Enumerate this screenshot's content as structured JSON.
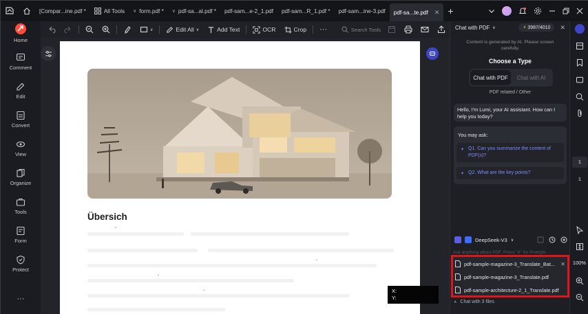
{
  "tabs": [
    {
      "label": "[Compar...ine.pdf *",
      "active": false
    },
    {
      "label": "All Tools",
      "active": false
    },
    {
      "label": "form.pdf *",
      "active": false
    },
    {
      "label": "pdf-sa...al.pdf *",
      "active": false
    },
    {
      "label": "pdf-sam...e-2_1.pdf",
      "active": false
    },
    {
      "label": "pdf-sam...R_1.pdf *",
      "active": false
    },
    {
      "label": "pdf-sam...ine-3.pdf",
      "active": false
    },
    {
      "label": "pdf-sa...te.pdf",
      "active": true
    }
  ],
  "left_sidebar": [
    {
      "label": "Home",
      "icon": "home-icon"
    },
    {
      "label": "Comment",
      "icon": "comment-icon"
    },
    {
      "label": "Edit",
      "icon": "edit-icon"
    },
    {
      "label": "Convert",
      "icon": "convert-icon"
    },
    {
      "label": "View",
      "icon": "view-icon"
    },
    {
      "label": "Organize",
      "icon": "organize-icon"
    },
    {
      "label": "Tools",
      "icon": "tools-icon"
    },
    {
      "label": "Form",
      "icon": "form-icon"
    },
    {
      "label": "Protect",
      "icon": "protect-icon"
    }
  ],
  "toolbar": {
    "edit_all": "Edit All",
    "add_text": "Add Text",
    "ocr": "OCR",
    "crop": "Crop",
    "more": "···",
    "search_tools": "Search Tools"
  },
  "document": {
    "heading": "Übersich",
    "coord_x": "X:",
    "coord_y": "Y:"
  },
  "chat": {
    "header_title": "Chat with PDF",
    "credits": "3987/4010",
    "ai_notice": "Content is generated by AI. Please screen carefully.",
    "choose_type": "Choose a Type",
    "type_pdf": "Chat with PDF",
    "type_ai": "Chat with AI",
    "pdf_related": "PDF related / Other",
    "greeting": "Hello, I'm Lumi, your AI assistant. How can I help you today?",
    "you_may_ask": "You may ask:",
    "q1": "Q1. Can you summarize the content of PDF(s)?",
    "q2": "Q2. What are the key points?",
    "model": "DeepSeek-V3",
    "input_hint": "Ask anything about PDF. Press \"#\" for Prompts",
    "files": [
      "pdf-sample-magazine-3_Translate_Bat...",
      "pdf-sample-magazine-3_Translate.pdf",
      "pdf-sample-architecture-2_1_Translate.pdf"
    ],
    "chat_with_files": "Chat with 3 files"
  },
  "right_rail": {
    "page_current": "1",
    "page_total": "1",
    "zoom": "100%"
  },
  "colors": {
    "accent_blue": "#7e8cff",
    "highlight_red": "#e0141a",
    "dark_bg": "#1b1c21"
  }
}
